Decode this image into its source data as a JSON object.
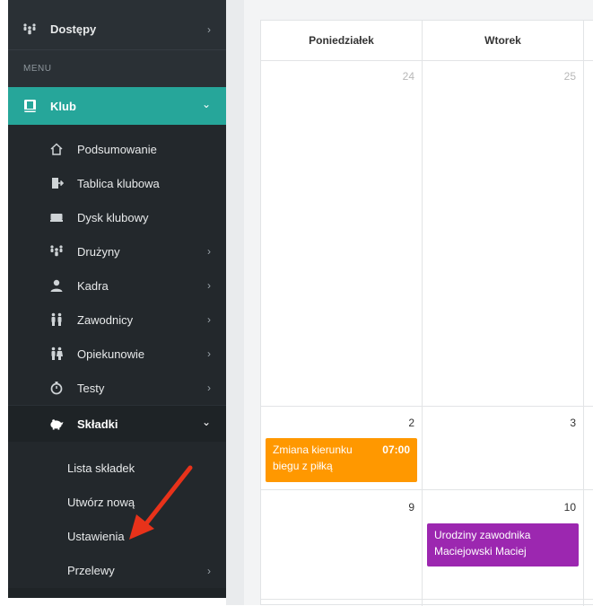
{
  "sidebar": {
    "dostepy": "Dostępy",
    "menu_header": "MENU",
    "klub": "Klub",
    "items": [
      {
        "label": "Podsumowanie",
        "icon": "home-icon"
      },
      {
        "label": "Tablica klubowa",
        "icon": "door-exit-icon"
      },
      {
        "label": "Dysk klubowy",
        "icon": "drive-icon"
      },
      {
        "label": "Drużyny",
        "icon": "team-icon"
      },
      {
        "label": "Kadra",
        "icon": "staff-icon"
      },
      {
        "label": "Zawodnicy",
        "icon": "players-icon"
      },
      {
        "label": "Opiekunowie",
        "icon": "guardians-icon"
      },
      {
        "label": "Testy",
        "icon": "stopwatch-icon"
      },
      {
        "label": "Składki",
        "icon": "piggy-bank-icon"
      }
    ],
    "skladki_sub": [
      "Lista składek",
      "Utwórz nową",
      "Ustawienia",
      "Przelewy"
    ],
    "chevron_right": "›",
    "chevron_down": "⌄"
  },
  "calendar": {
    "headers": [
      "Poniedziałek",
      "Wtorek"
    ],
    "days": {
      "d24": "24",
      "d25": "25",
      "d2": "2",
      "d3": "3",
      "d9": "9",
      "d10": "10"
    },
    "events": {
      "e1_title": "Zmiana kierunku biegu z piłką",
      "e1_time": "07:00",
      "e2_title": "Urodziny zawodnika Maciejowski Maciej"
    }
  },
  "colors": {
    "accent": "#26a69a",
    "sidebar_bg": "#2a3035",
    "event_orange": "#ff9800",
    "event_purple": "#9c27b0",
    "arrow": "#e8321a"
  }
}
